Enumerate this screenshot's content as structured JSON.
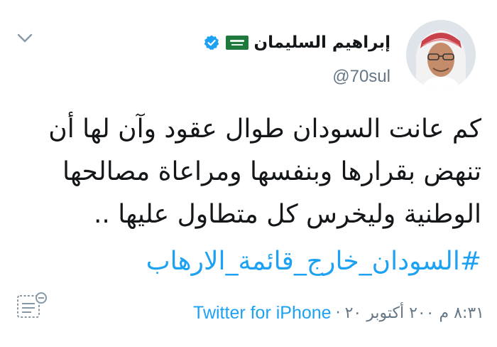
{
  "user": {
    "display_name": "إبراهيم السليمان",
    "handle": "@70sul",
    "verified": true,
    "flag": "saudi-arabia-flag"
  },
  "tweet": {
    "text": "كم عانت السودان طوال عقود وآن لها أن\nتنهض بقرارها وبنفسها ومراعاة مصالحها\nالوطنية وليخرس كل متطاول عليها ..",
    "hashtag": "#السودان_خارج_قائمة_الارهاب"
  },
  "meta": {
    "datetime": "٨:٣١ م ٢٠٠ أكتوبر ٢٠",
    "separator": "·",
    "source": "Twitter for iPhone"
  },
  "colors": {
    "text": "#14171a",
    "secondary": "#657786",
    "link": "#1da1f2",
    "verified": "#1da1f2"
  },
  "icons": {
    "menu": "chevron-down-icon",
    "thread": "thread-icon"
  }
}
